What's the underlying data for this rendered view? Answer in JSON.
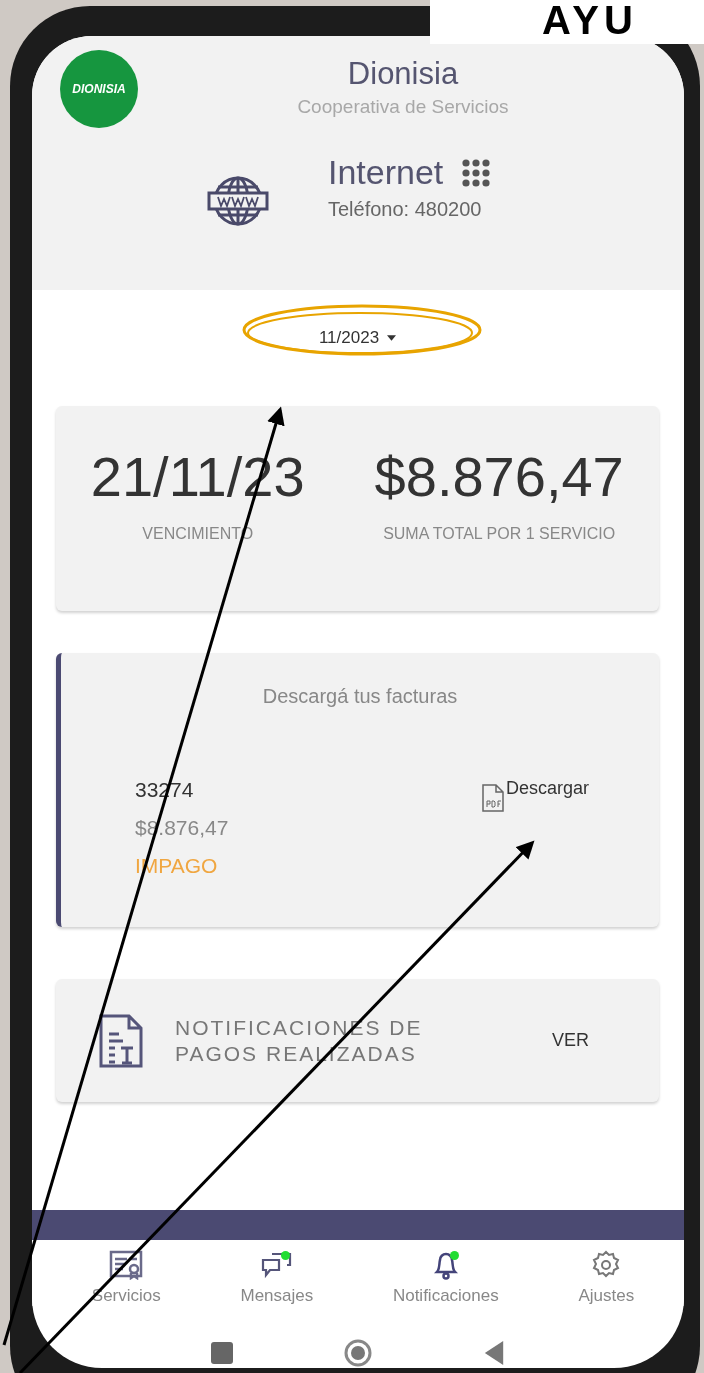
{
  "banner": {
    "text": "AYU"
  },
  "header": {
    "logo_text": "DIONISIA",
    "title": "Dionisia",
    "subtitle": "Cooperativa de Servicios"
  },
  "service": {
    "name": "Internet",
    "phone": "Teléfono: 480200"
  },
  "period": {
    "value": "11/2023"
  },
  "summary": {
    "due_date": "21/11/23",
    "due_label": "VENCIMIENTO",
    "total": "$8.876,47",
    "total_label": "SUMA TOTAL POR 1 SERVICIO"
  },
  "invoices": {
    "title": "Descargá tus facturas",
    "items": [
      {
        "number": "33274",
        "amount": "$8.876,47",
        "status": "IMPAGO",
        "paid": false,
        "download": "Descargar"
      }
    ]
  },
  "payments": {
    "label": "NOTIFICACIONES DE PAGOS REALIZADAS",
    "action": "VER"
  },
  "nav": [
    {
      "label": "Servicios",
      "kind": "services",
      "badge": false
    },
    {
      "label": "Mensajes",
      "kind": "messages",
      "badge": true
    },
    {
      "label": "Notificaciones",
      "kind": "bell",
      "badge": true
    },
    {
      "label": "Ajustes",
      "kind": "settings",
      "badge": false
    }
  ]
}
